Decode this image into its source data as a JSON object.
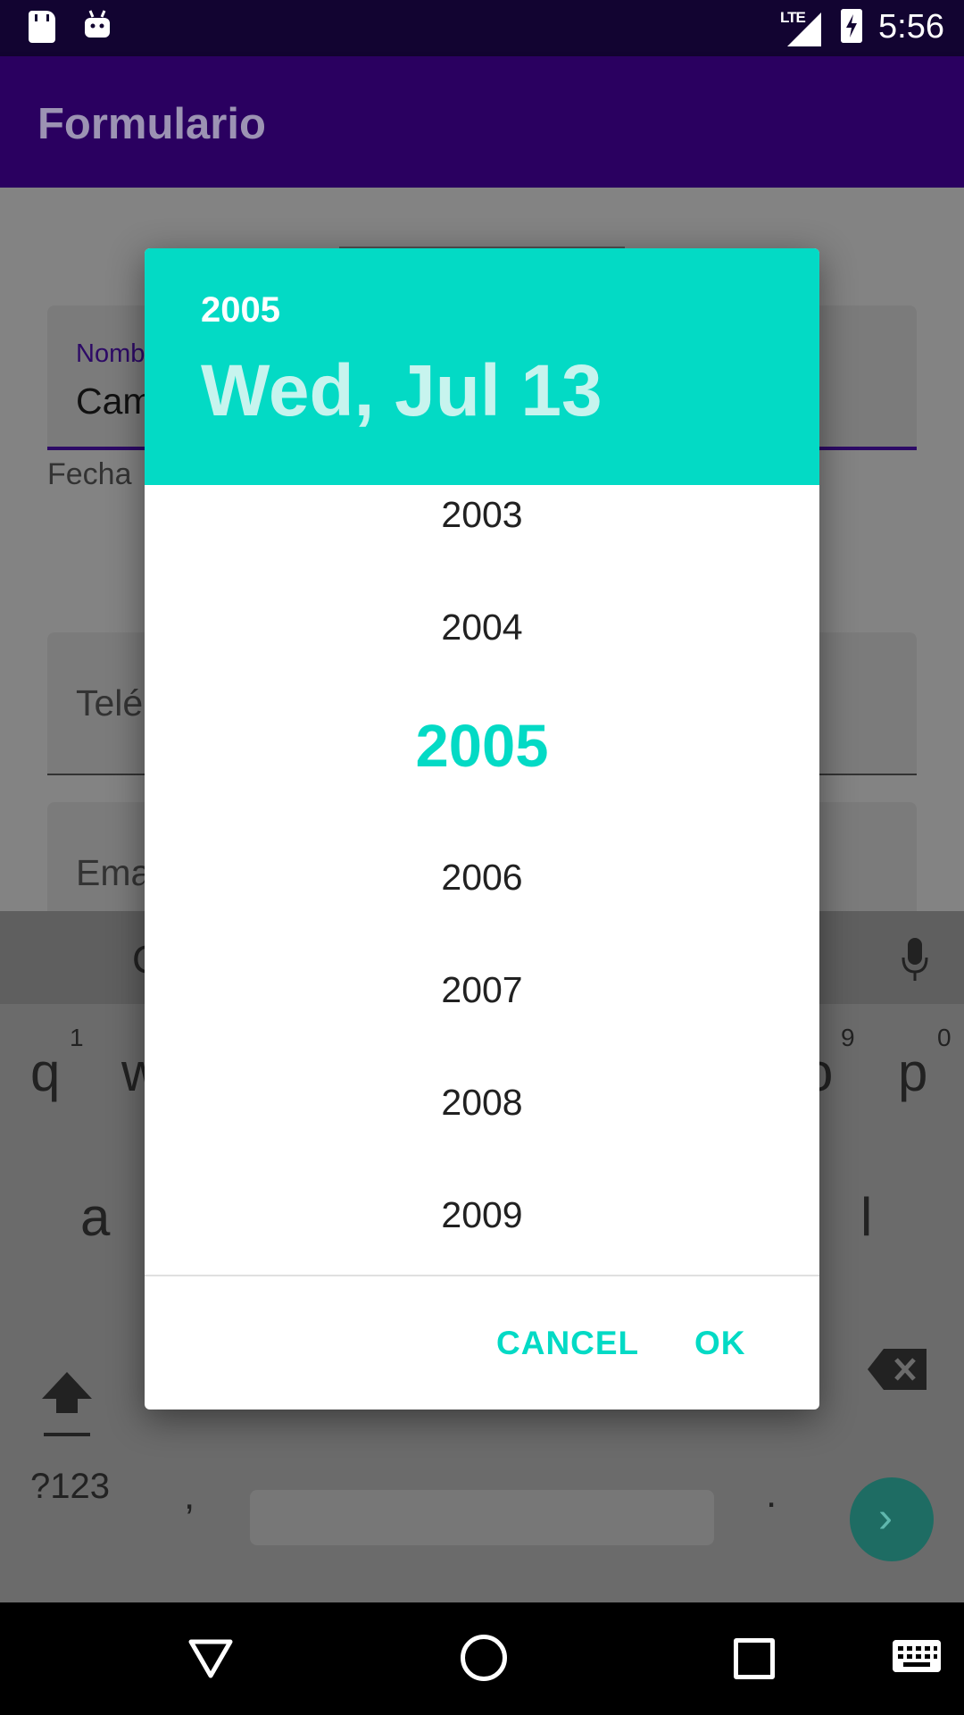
{
  "status_bar": {
    "time": "5:56",
    "network": "LTE",
    "icons": [
      "sd-card-icon",
      "android-icon",
      "signal-icon",
      "battery-charging-icon"
    ]
  },
  "app_bar": {
    "title": "Formulario"
  },
  "form": {
    "name_label": "Nomb",
    "name_value": "Cam",
    "fecha_label": "Fecha",
    "phone_hint": "Telé",
    "email_hint": "Ema"
  },
  "keyboard": {
    "suggestion_partial": "C",
    "row1_left": [
      "q",
      "w"
    ],
    "row1_left_nums": [
      "1"
    ],
    "row1_right": [
      "o",
      "p"
    ],
    "row1_right_nums": [
      "9",
      "0"
    ],
    "row2_left": "a",
    "row2_right": "l",
    "symbols_key": "?123",
    "comma_key": ",",
    "period_key": ".",
    "enter_glyph": "›"
  },
  "date_picker": {
    "header_year": "2005",
    "header_date": "Wed, Jul 13",
    "years": [
      "2003",
      "2004",
      "2005",
      "2006",
      "2007",
      "2008",
      "2009"
    ],
    "selected_year": "2005",
    "cancel_label": "CANCEL",
    "ok_label": "OK",
    "accent_color": "#03dac5"
  },
  "nav_bar": {
    "icons": [
      "back-icon",
      "home-icon",
      "recents-icon",
      "keyboard-icon"
    ]
  }
}
